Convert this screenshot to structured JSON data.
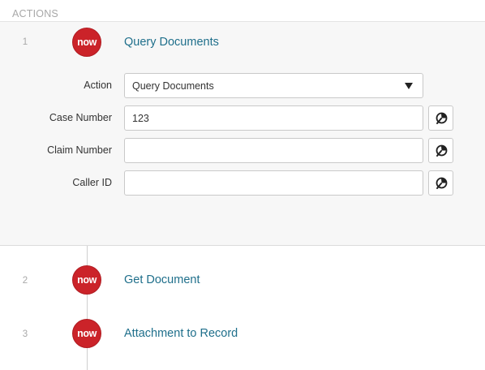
{
  "section": {
    "title": "ACTIONS"
  },
  "actions": [
    {
      "number": "1",
      "badge": "now",
      "title": "Query Documents",
      "fields": {
        "action": {
          "label": "Action",
          "value": "Query Documents"
        },
        "case_number": {
          "label": "Case Number",
          "value": "123"
        },
        "claim_number": {
          "label": "Claim Number",
          "value": ""
        },
        "caller_id": {
          "label": "Caller ID",
          "value": ""
        }
      }
    },
    {
      "number": "2",
      "badge": "now",
      "title": "Get Document"
    },
    {
      "number": "3",
      "badge": "now",
      "title": "Attachment to Record"
    }
  ],
  "colors": {
    "brand_red": "#cb2329",
    "link_teal": "#1f6f8b",
    "panel_bg": "#f7f7f7"
  },
  "icons": {
    "datapill": "data-pill-picker-icon",
    "select_caret": "caret-down-icon"
  }
}
